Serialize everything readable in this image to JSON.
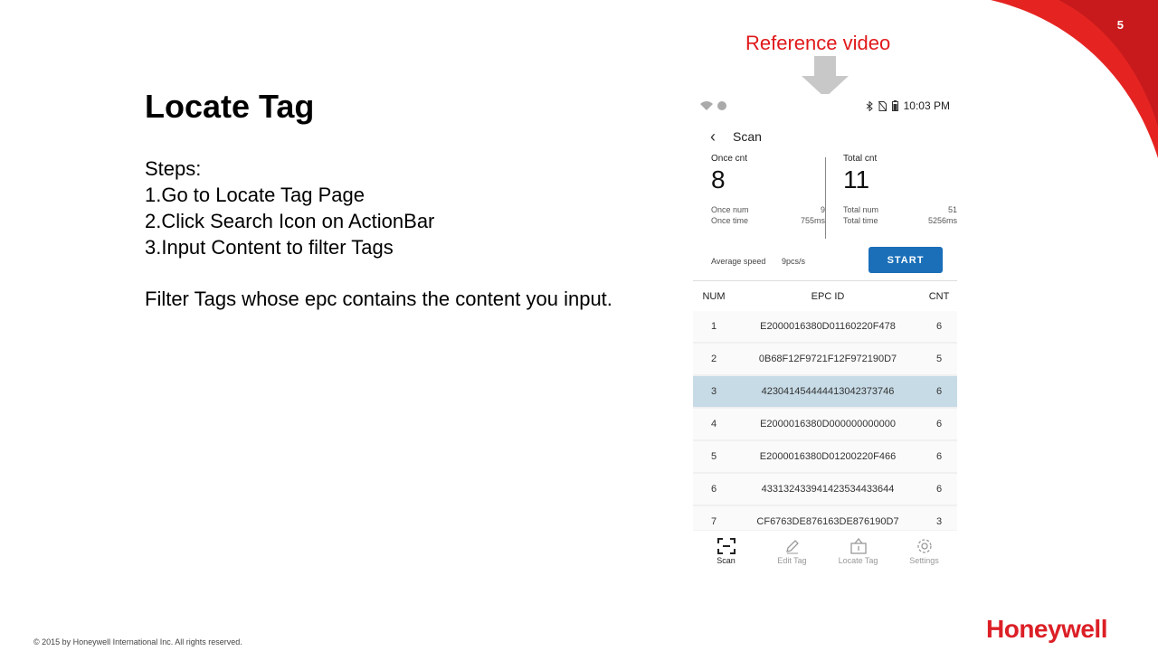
{
  "slide": {
    "page_number": "5",
    "title": "Locate Tag",
    "steps_heading": "Steps:",
    "steps": [
      "1.Go to Locate Tag Page",
      "2.Click Search Icon on ActionBar",
      "3.Input Content to filter Tags"
    ],
    "note": "Filter Tags whose epc  contains the content you input.",
    "reference_label": "Reference video",
    "copyright": "© 2015 by Honeywell International Inc. All rights reserved.",
    "logo_text": "Honeywell",
    "colors": {
      "brand_red": "#dc1f26",
      "accent_blue": "#1a6fb8",
      "selected_row": "#c7dbe6"
    }
  },
  "phone": {
    "status_time": "10:03 PM",
    "appbar_title": "Scan",
    "once": {
      "label": "Once cnt",
      "value": "8",
      "num_label": "Once num",
      "num_value": "9",
      "time_label": "Once time",
      "time_value": "755ms"
    },
    "total": {
      "label": "Total cnt",
      "value": "11",
      "num_label": "Total num",
      "num_value": "51",
      "time_label": "Total time",
      "time_value": "5256ms"
    },
    "speed_label": "Average speed",
    "speed_value": "9pcs/s",
    "start_label": "START",
    "table_headers": {
      "num": "NUM",
      "epc": "EPC ID",
      "cnt": "CNT"
    },
    "rows": [
      {
        "num": "1",
        "epc": "E2000016380D01160220F478",
        "cnt": "6"
      },
      {
        "num": "2",
        "epc": "0B68F12F9721F12F972190D7",
        "cnt": "5"
      },
      {
        "num": "3",
        "epc": "423041454444413042373746",
        "cnt": "6"
      },
      {
        "num": "4",
        "epc": "E2000016380D000000000000",
        "cnt": "6"
      },
      {
        "num": "5",
        "epc": "E2000016380D01200220F466",
        "cnt": "6"
      },
      {
        "num": "6",
        "epc": "433132433941423534433644",
        "cnt": "6"
      },
      {
        "num": "7",
        "epc": "CF6763DE876163DE876190D7",
        "cnt": "3"
      }
    ],
    "selected_row": 3,
    "nav": [
      {
        "label": "Scan",
        "icon": "scan-icon",
        "active": true
      },
      {
        "label": "Edit Tag",
        "icon": "pencil-icon",
        "active": false
      },
      {
        "label": "Locate Tag",
        "icon": "locate-icon",
        "active": false
      },
      {
        "label": "Settings",
        "icon": "gear-icon",
        "active": false
      }
    ]
  }
}
